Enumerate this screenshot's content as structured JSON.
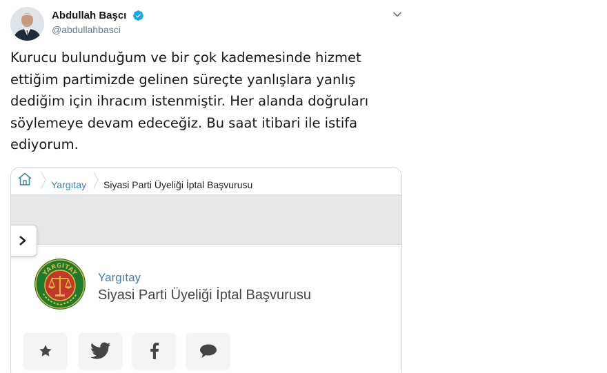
{
  "tweet": {
    "author_name": "Abdullah Başcı",
    "handle": "@abdullahbasci",
    "text": "Kurucu bulunduğum ve bir çok kademesinde hizmet\nettiğim partimizde gelinen süreçte yanlışlara yanlış\ndediğim için ihracım istenmiştir. Her alanda doğruları\nsöylemeye devam edeceğiz. Bu saat itibari ile istifa\nediyorum."
  },
  "card": {
    "breadcrumb": {
      "link": "Yargıtay",
      "current": "Siyasi Parti Üyeliği İptal Başvurusu"
    },
    "site_name": "Yargıtay",
    "page_title": "Siyasi Parti Üyeliği İptal Başvurusu",
    "logo_text": "YARGITAY",
    "share_buttons": [
      "star-icon",
      "twitter-icon",
      "facebook-icon",
      "comment-icon"
    ]
  },
  "colors": {
    "verified": "#1da1f2",
    "link": "#3f7fb6",
    "logo_green": "#1e7a2e",
    "logo_red": "#c0392b",
    "logo_gold": "#e2b93b"
  }
}
